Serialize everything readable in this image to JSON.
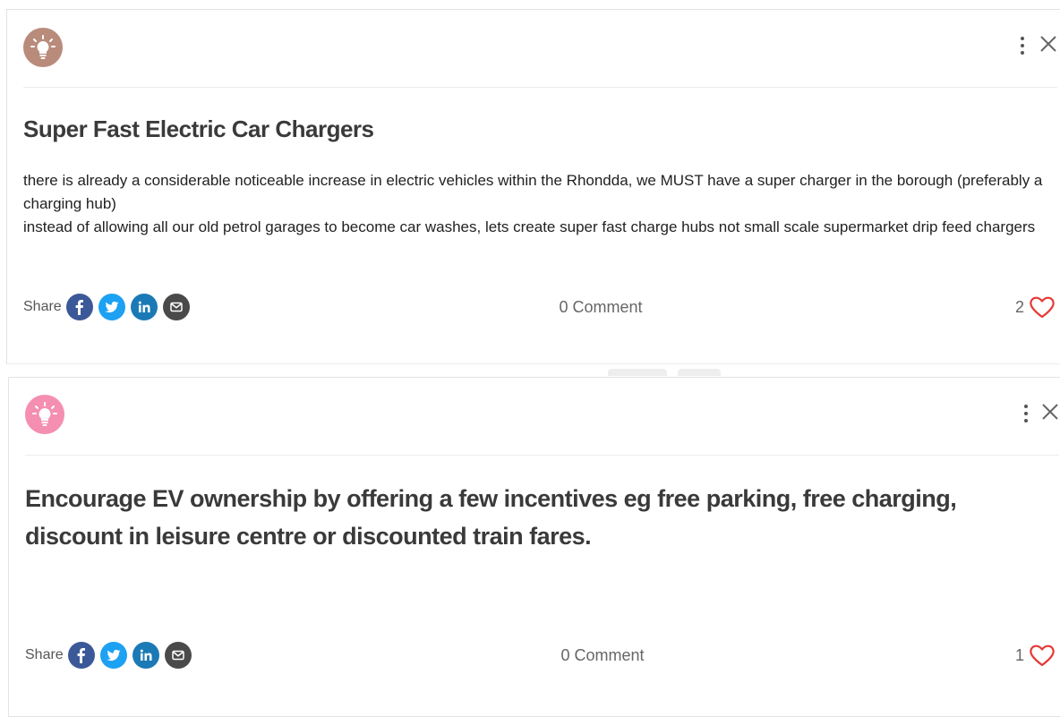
{
  "posts": [
    {
      "avatar_color": "#b98b7b",
      "title": "Super Fast Electric Car Chargers",
      "body": [
        "there is already a considerable noticeable increase in electric vehicles within the Rhondda, we MUST have a super charger in the borough (preferably a charging hub)",
        "instead of allowing all our old petrol garages to become car washes, lets create super fast charge hubs not small scale supermarket drip feed chargers"
      ],
      "share_label": "Share",
      "comments": "0 Comment",
      "likes": "2"
    },
    {
      "avatar_color": "#f48fb1",
      "title": "Encourage EV ownership by offering a few incentives eg free parking, free charging, discount in leisure centre or discounted train fares.",
      "share_label": "Share",
      "comments": "0 Comment",
      "likes": "1"
    }
  ],
  "icons": {
    "avatar": "lightbulb-icon",
    "more": "more-vertical-icon",
    "close": "close-icon",
    "facebook": "facebook-icon",
    "twitter": "twitter-icon",
    "linkedin": "linkedin-icon",
    "email": "email-icon",
    "like": "heart-icon"
  },
  "colors": {
    "facebook": "#3b5998",
    "twitter": "#1da1f2",
    "linkedin": "#1b7ab5",
    "email": "#4a4a4a",
    "heart": "#e53935",
    "title_text": "#3a3a3a"
  }
}
